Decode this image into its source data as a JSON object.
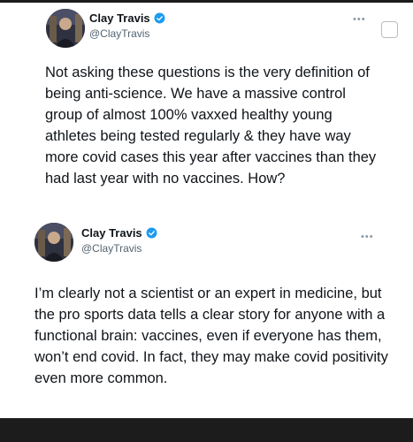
{
  "tweets": [
    {
      "author": {
        "name": "Clay Travis",
        "handle": "@ClayTravis",
        "verified": true
      },
      "more_icon": "more-horizontal-icon",
      "text": "Not asking these questions is the very definition of being anti-science. We have a massive control group of almost 100% vaxxed healthy young athletes being tested regularly & they have way more covid cases this year after vaccines than they had last year with no vaccines. How?"
    },
    {
      "author": {
        "name": "Clay Travis",
        "handle": "@ClayTravis",
        "verified": true
      },
      "more_icon": "more-horizontal-icon",
      "text": "I’m clearly not a scientist or an expert in medicine, but the pro sports data tells a clear story for anyone with a functional brain: vaccines, even if everyone has them, won’t end covid. In fact, they may make covid positivity even more common."
    }
  ],
  "colors": {
    "verified_badge": "#1d9bf0",
    "text_primary": "#0f1419",
    "text_secondary": "#536471",
    "frame": "#1c1c1c"
  },
  "icons": {
    "verified": "verified-badge-icon",
    "more": "more-horizontal-icon",
    "checkbox": "select-checkbox"
  }
}
